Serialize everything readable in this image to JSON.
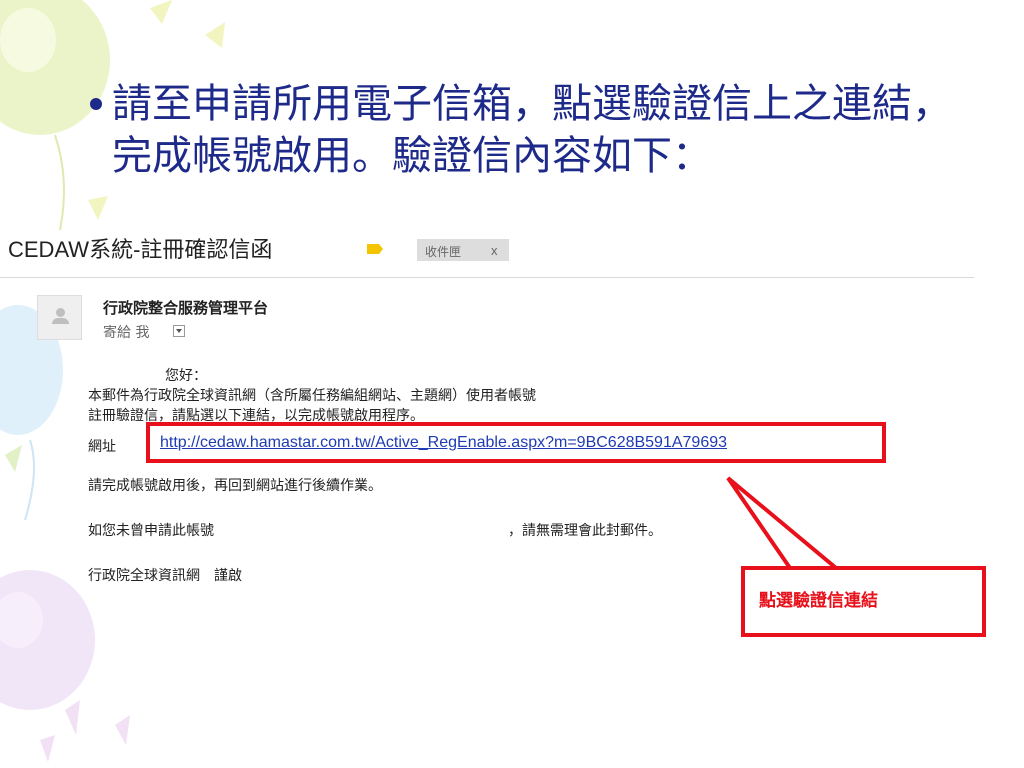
{
  "slide": {
    "bullet_text": "請至申請所用電子信箱，點選驗證信上之連結，完成帳號啟用。驗證信內容如下："
  },
  "email": {
    "subject": "CEDAW系統-註冊確認信函",
    "label_color": "#f5c400",
    "inbox_label": "收件匣",
    "inbox_close": "x",
    "sender": "行政院整合服務管理平台",
    "recipient": "寄給 我",
    "body": {
      "greeting": "您好：",
      "line1": "本郵件為行政院全球資訊網（含所屬任務編組網站、主題網）使用者帳號",
      "line2": "註冊驗證信，請點選以下連結，以完成帳號啟用程序。",
      "url_label": "網址",
      "url": "http://cedaw.hamastar.com.tw/Active_RegEnable.aspx?m=9BC628B591A79693",
      "after_activation": "請完成帳號啟用後，再回到網站進行後續作業。",
      "not_applied_prefix": "如您未曾申請此帳號",
      "not_applied_suffix": "，請無需理會此封郵件。",
      "signature": "行政院全球資訊網　謹啟"
    }
  },
  "annotation": {
    "callout_text": "點選驗證信連結",
    "highlight_color": "#e8101a"
  }
}
